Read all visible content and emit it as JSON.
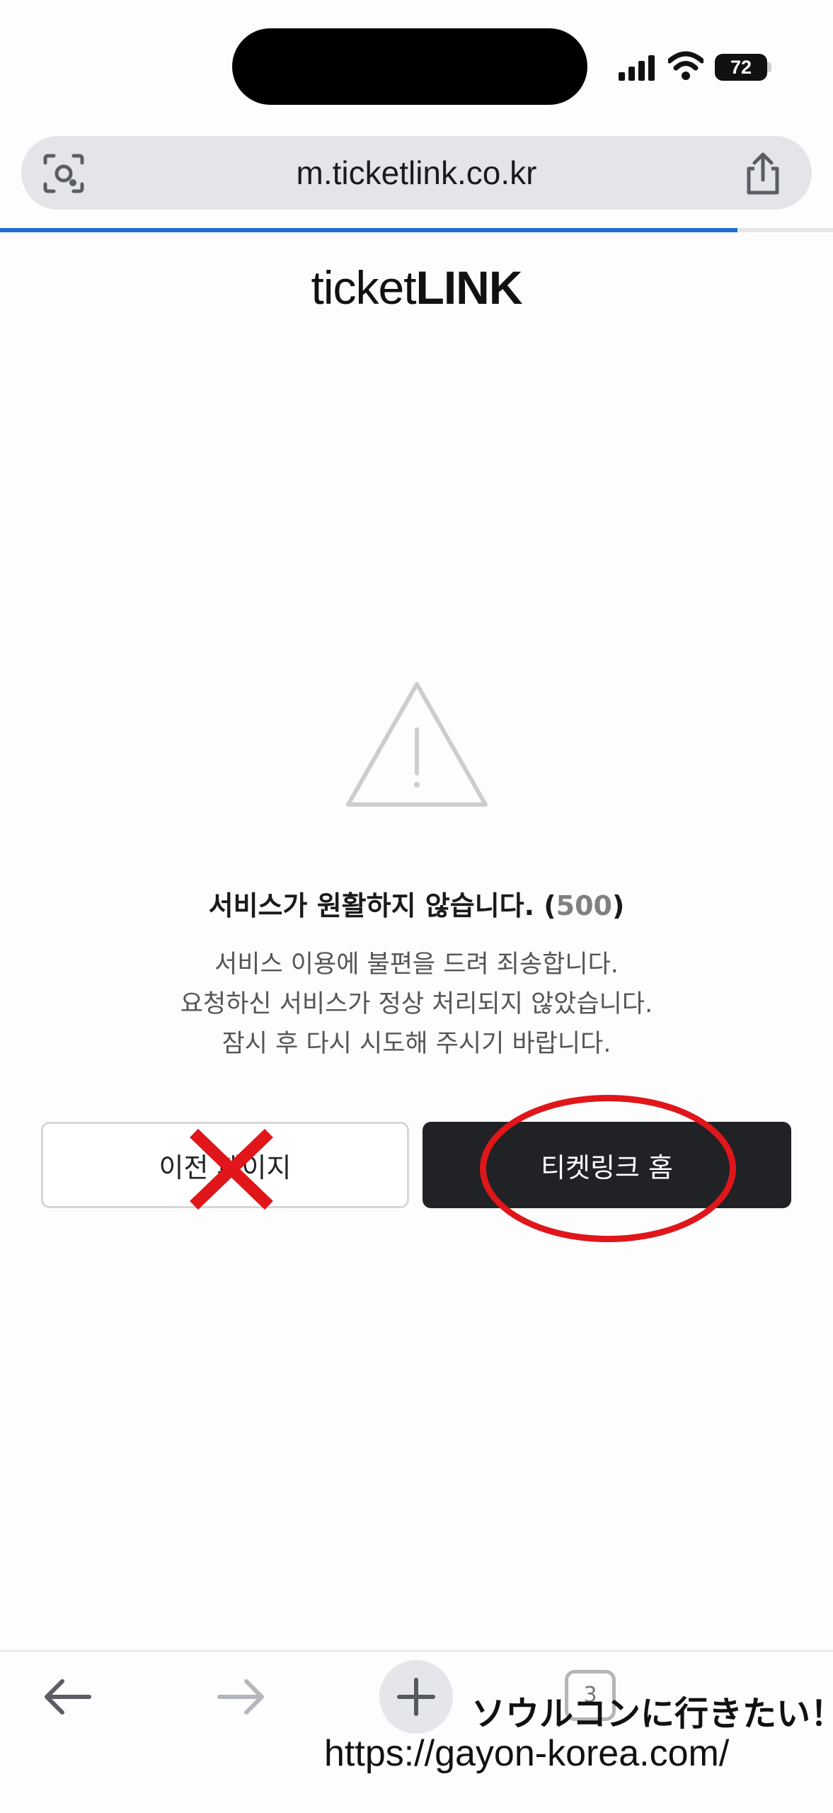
{
  "status_bar": {
    "battery": "72"
  },
  "browser": {
    "url": "m.ticketlink.co.kr",
    "load_progress": 0.885,
    "tab_count": "3"
  },
  "page": {
    "logo_light": "ticket",
    "logo_bold": "LINK",
    "error_title": "서비스가 원활하지 않습니다. (",
    "error_code": "500",
    "error_title_end": ")",
    "error_lines": [
      "서비스 이용에 불편을 드려 죄송합니다.",
      "요청하신 서비스가 정상 처리되지 않았습니다.",
      "잠시 후 다시 시도해 주시기 바랍니다."
    ],
    "prev_button": "이전 페이지",
    "home_button": "티켓링크 홈"
  },
  "annotations": {
    "cross_color": "#e0161a",
    "circle_color": "#e0161a"
  },
  "watermark": {
    "line1": "ソウルコンに行きたい！",
    "line2": "https://gayon-korea.com/"
  },
  "icons": [
    "lens-icon",
    "share-icon",
    "warning-icon",
    "back-arrow-icon",
    "forward-arrow-icon",
    "plus-icon",
    "tabs-icon"
  ]
}
